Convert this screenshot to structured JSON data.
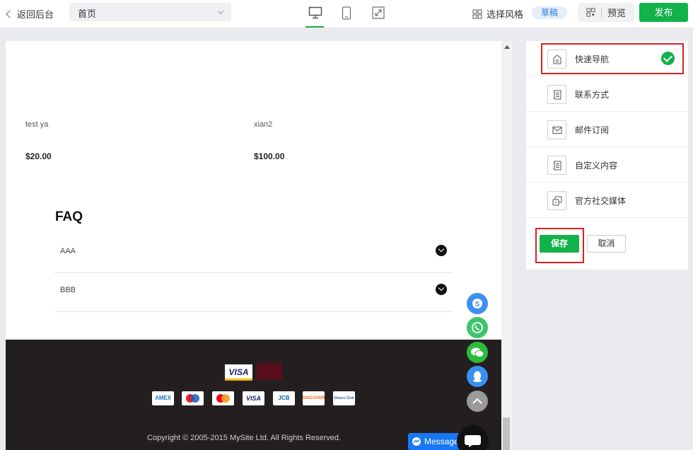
{
  "topbar": {
    "back_label": "返回后台",
    "page_select_value": "首页",
    "style_label": "选择风格",
    "draft_badge": "草稿",
    "preview_label": "预览",
    "publish_label": "发布"
  },
  "canvas": {
    "products": [
      {
        "name": "test ya",
        "price": "$20.00"
      },
      {
        "name": "xian2",
        "price": "$100.00"
      }
    ],
    "faq": {
      "title": "FAQ",
      "items": [
        "AAA",
        "BBB"
      ]
    },
    "footer": {
      "visa_label": "VISA",
      "cards": [
        "AMEX",
        "maestro",
        "mastercard",
        "VISA",
        "JCB",
        "DISCOVER",
        "Diners Club"
      ],
      "copyright": "Copyright © 2005-2015 MySite Ltd. All Rights Reserved."
    },
    "messenger_label": "Message"
  },
  "panel": {
    "items": [
      {
        "label": "快速导航",
        "icon": "nav-icon",
        "selected": true
      },
      {
        "label": "联系方式",
        "icon": "contact-icon"
      },
      {
        "label": "邮件订阅",
        "icon": "mail-icon"
      },
      {
        "label": "自定义内容",
        "icon": "custom-content-icon"
      },
      {
        "label": "官方社交媒体",
        "icon": "social-media-icon"
      }
    ],
    "save_label": "保存",
    "cancel_label": "取消"
  },
  "colors": {
    "accent": "#12b24a",
    "highlight": "#e0201d",
    "footer_bg": "#231f20"
  }
}
